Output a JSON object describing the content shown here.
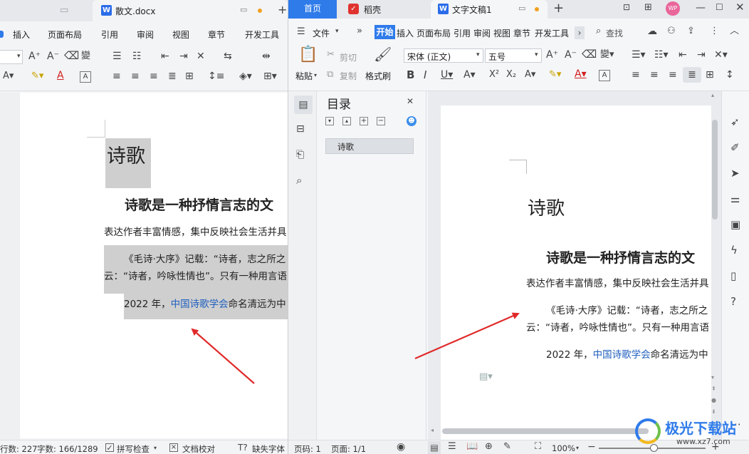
{
  "left_window": {
    "tab_title": "散文.docx",
    "menu": [
      "插入",
      "页面布局",
      "引用",
      "审阅",
      "视图",
      "章节",
      "开发工具"
    ],
    "doc": {
      "title": "诗歌",
      "heading": "诗歌是一种抒情言志的文",
      "para1": "表达作者丰富情感，集中反映社会生活并具",
      "para2a": "《毛诗·大序》记载：“诗者，志之所之",
      "para2b": "云：“诗者，吟咏性情也”。只有一种用言语",
      "para3_prefix": "2022 年，",
      "para3_link": "中国诗歌学会",
      "para3_suffix": "命名清远为中"
    },
    "status": {
      "lines": "行数: 227",
      "words": "字数: 166/1289",
      "spellcheck": "拼写检查",
      "proofread": "文档校对",
      "missing_font": "缺失字体"
    }
  },
  "right_window": {
    "tabs": {
      "home": "首页",
      "daoke": "稻壳",
      "doc": "文字文稿1"
    },
    "avatar": "WP",
    "menu": {
      "file": "文件",
      "items": [
        "开始",
        "插入",
        "页面布局",
        "引用",
        "审阅",
        "视图",
        "章节",
        "开发工具"
      ],
      "search": "查找"
    },
    "ribbon": {
      "paste": "粘贴",
      "cut": "剪切",
      "copy": "复制",
      "format_painter": "格式刷",
      "font": "宋体 (正文)",
      "size": "五号"
    },
    "toc": {
      "title": "目录",
      "item": "诗歌"
    },
    "doc": {
      "title": "诗歌",
      "heading": "诗歌是一种抒情言志的文",
      "para1": "表达作者丰富情感，集中反映社会生活并具",
      "para2a": "《毛诗·大序》记载：“诗者，志之所之",
      "para2b": "云：“诗者，吟咏性情也”。只有一种用言语",
      "para3_prefix": "2022 年，",
      "para3_link": "中国诗歌学会",
      "para3_suffix": "命名清远为中"
    },
    "status": {
      "page_num": "页码: 1",
      "pages": "页面: 1/1",
      "zoom": "100%"
    }
  },
  "watermark": {
    "text": "极光下载站",
    "url": "www.xz7.com"
  },
  "colors": {
    "accent": "#2f7bea",
    "arrow": "#e02a2a",
    "link": "#1f5fbf",
    "highlight": "#cfcfcf"
  }
}
